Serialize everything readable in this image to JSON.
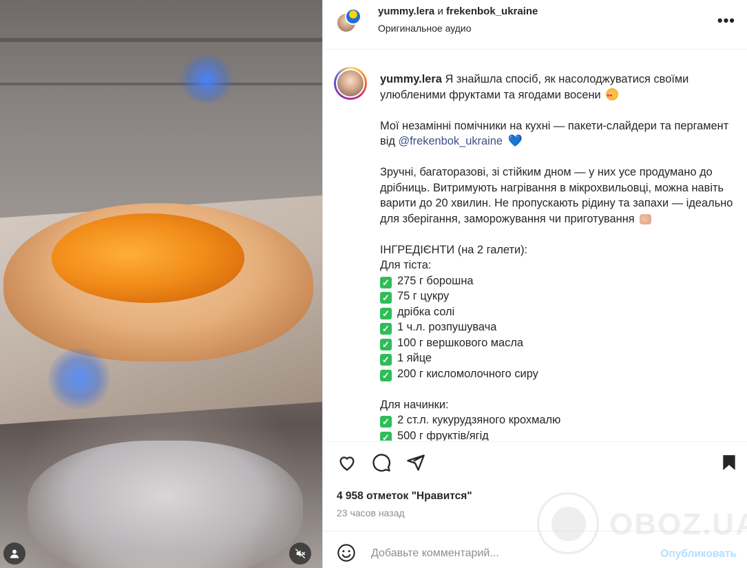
{
  "post": {
    "header": {
      "user1": "yummy.lera",
      "conjunction": "и",
      "user2": "frekenbok_ukraine",
      "audio": "Оригинальное аудио"
    },
    "caption": {
      "username": "yummy.lera",
      "line1": "Я знайшла спосіб, як насолоджуватися своїми улюбленими фруктами та ягодами восени",
      "line2_a": "Мої незамінні помічники на кухні — пакети-слайдери та пергамент від",
      "mention": "@frekenbok_ukraine",
      "line3": "Зручні, багаторазові, зі стійким дном — у них усе продумано до дрібниць. Витримують нагрівання в мікрохвильовці, можна навіть варити до 20 хвилин. Не пропускають рідину та запахи — ідеально для зберігання, заморожування чи приготування",
      "ingredients_title": "ІНГРЕДІЄНТИ (на 2 галети):",
      "dough_title": "Для тіста:",
      "dough_items": [
        "275 г борошна",
        "75 г цукру",
        "дрібка солі",
        "1 ч.л. розпушувача",
        "100 г вершкового масла",
        "1 яйце",
        "200 г кисломолочного сиру"
      ],
      "filling_title": "Для начинки:",
      "filling_items": [
        "2 ст.л. кукурудзяного крохмалю",
        "500 г фруктів/ягід"
      ]
    },
    "likes": "4 958 отметок \"Нравится\"",
    "time": "23 часов назад",
    "comment_placeholder": "Добавьте комментарий...",
    "publish_label": "Опубликовать",
    "more_label": "•••",
    "check_glyph": "✓",
    "icons": {
      "like": "heart-icon",
      "comment": "comment-icon",
      "share": "send-icon",
      "save": "bookmark-icon",
      "emoji": "smiley-icon",
      "user_tag": "user-icon",
      "mute": "speaker-muted-icon"
    }
  },
  "watermark": {
    "text": "OBOZ.UA"
  }
}
